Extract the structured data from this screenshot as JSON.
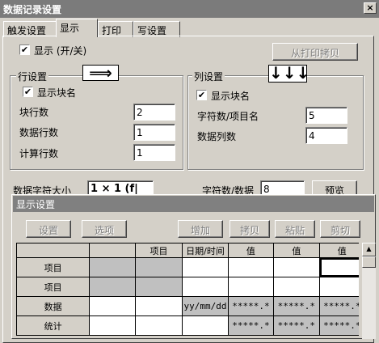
{
  "window": {
    "title": "数据记录设置",
    "close_glyph": "×"
  },
  "tabs": [
    {
      "label": "触发设置"
    },
    {
      "label": "显示"
    },
    {
      "label": "打印"
    },
    {
      "label": "写设置"
    }
  ],
  "display_tab": {
    "show_checkbox": {
      "label": "显示 (开/关)",
      "checked": true,
      "mark": "✔"
    },
    "copy_from_print_button": "从打印拷贝",
    "row_settings": {
      "legend": "行设置",
      "arrow_glyph": "⟹",
      "show_block_name": {
        "label": "显示块名",
        "checked": true,
        "mark": "✔"
      },
      "fields": [
        {
          "label": "块行数",
          "value": "2"
        },
        {
          "label": "数据行数",
          "value": "1"
        },
        {
          "label": "计算行数",
          "value": "1"
        }
      ]
    },
    "col_settings": {
      "legend": "列设置",
      "arrow_glyph": "↓↓↓",
      "show_block_name": {
        "label": "显示块名",
        "checked": true,
        "mark": "✔"
      },
      "fields": [
        {
          "label": "字符数/项目名",
          "value": "5"
        },
        {
          "label": "数据列数",
          "value": "4"
        }
      ]
    },
    "data_char_size": {
      "label": "数据字符大小",
      "value": "1 × 1 (f|"
    },
    "chars_per_data": {
      "label": "字符数/数据",
      "value": "8"
    },
    "preview_button": "预览"
  },
  "display_settings_dialog": {
    "title": "显示设置",
    "toolbar": {
      "settings": "设置",
      "options": "选项",
      "add": "增加",
      "copy": "拷贝",
      "paste": "粘贴",
      "cut": "剪切"
    },
    "grid": {
      "header": [
        "",
        "",
        "项目",
        "日期/时间",
        "值",
        "值",
        "值"
      ],
      "rows": [
        {
          "label": "项目",
          "cells": [
            "",
            "",
            "",
            "",
            "",
            ""
          ]
        },
        {
          "label": "项目",
          "cells": [
            "",
            "",
            "",
            "",
            "",
            ""
          ]
        },
        {
          "label": "数据",
          "cells": [
            "",
            "",
            "yy/mm/dd",
            "*****.*",
            "*****.*",
            "*****.*"
          ]
        },
        {
          "label": "统计",
          "cells": [
            "",
            "",
            "",
            "*****.*",
            "*****.*",
            "*****.*"
          ]
        }
      ]
    }
  }
}
